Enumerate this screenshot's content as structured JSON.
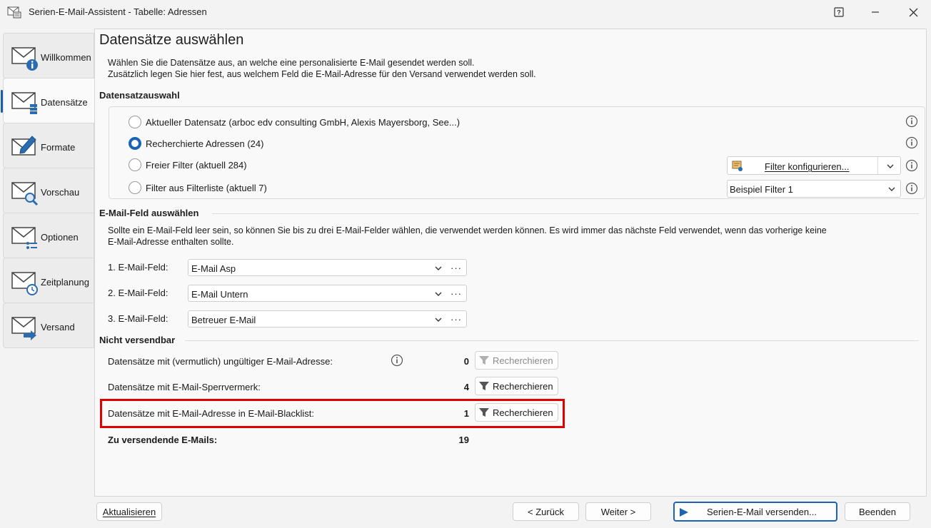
{
  "window": {
    "title": "Serien-E-Mail-Assistent - Tabelle: Adressen",
    "help_glyph": "?",
    "minimize_glyph": "—",
    "close_glyph": "✕"
  },
  "sidebar": {
    "items": [
      {
        "label": "Willkommen",
        "icon": "mail-info-icon",
        "active": false
      },
      {
        "label": "Datensätze",
        "icon": "mail-records-icon",
        "active": true
      },
      {
        "label": "Formate",
        "icon": "mail-edit-icon",
        "active": false
      },
      {
        "label": "Vorschau",
        "icon": "mail-preview-icon",
        "active": false
      },
      {
        "label": "Optionen",
        "icon": "mail-options-icon",
        "active": false
      },
      {
        "label": "Zeitplanung",
        "icon": "mail-schedule-icon",
        "active": false
      },
      {
        "label": "Versand",
        "icon": "mail-send-icon",
        "active": false
      }
    ]
  },
  "page": {
    "title": "Datensätze auswählen",
    "intro_line1": "Wählen Sie die Datensätze aus, an welche eine personalisierte E-Mail gesendet werden soll.",
    "intro_line2": "Zusätzlich legen Sie hier fest, aus welchem Feld die E-Mail-Adresse für den Versand verwendet werden soll."
  },
  "selection": {
    "heading": "Datensatzauswahl",
    "options": [
      {
        "label": "Aktueller Datensatz (arboc edv consulting GmbH, Alexis Mayersborg, See...)",
        "selected": false
      },
      {
        "label": "Recherchierte Adressen (24)",
        "selected": true
      },
      {
        "label": "Freier Filter (aktuell 284)",
        "selected": false
      },
      {
        "label": "Filter aus Filterliste (aktuell 7)",
        "selected": false
      }
    ],
    "filter_button_label": "Filter konfigurieren...",
    "filter_list_value": "Beispiel Filter 1"
  },
  "email_fields": {
    "heading": "E-Mail-Feld auswählen",
    "description_line1": "Sollte ein E-Mail-Feld leer sein, so können Sie bis zu drei E-Mail-Felder wählen, die verwendet werden können. Es wird immer das nächste Feld verwendet, wenn das vorherige keine",
    "description_line2": "E-Mail-Adresse enthalten sollte.",
    "fields": [
      {
        "label": "1. E-Mail-Feld:",
        "value": "E-Mail Asp"
      },
      {
        "label": "2. E-Mail-Feld:",
        "value": "E-Mail Untern"
      },
      {
        "label": "3. E-Mail-Feld:",
        "value": "Betreuer E-Mail"
      }
    ],
    "more_glyph": "···"
  },
  "not_sendable": {
    "heading": "Nicht versendbar",
    "rows": [
      {
        "label": "Datensätze mit (vermutlich) ungültiger E-Mail-Adresse:",
        "count": "0",
        "button": "Recherchieren",
        "enabled": false
      },
      {
        "label": "Datensätze mit E-Mail-Sperrvermerk:",
        "count": "4",
        "button": "Recherchieren",
        "enabled": true
      },
      {
        "label": "Datensätze mit E-Mail-Adresse in E-Mail-Blacklist:",
        "count": "1",
        "button": "Recherchieren",
        "enabled": true
      }
    ],
    "total_label": "Zu versendende E-Mails:",
    "total_count": "19"
  },
  "footer": {
    "refresh": "Aktualisieren",
    "back": "< Zurück",
    "next": "Weiter >",
    "send": "Serien-E-Mail versenden...",
    "finish": "Beenden"
  },
  "colors": {
    "accent": "#1b64b5",
    "highlight": "#e00000"
  }
}
